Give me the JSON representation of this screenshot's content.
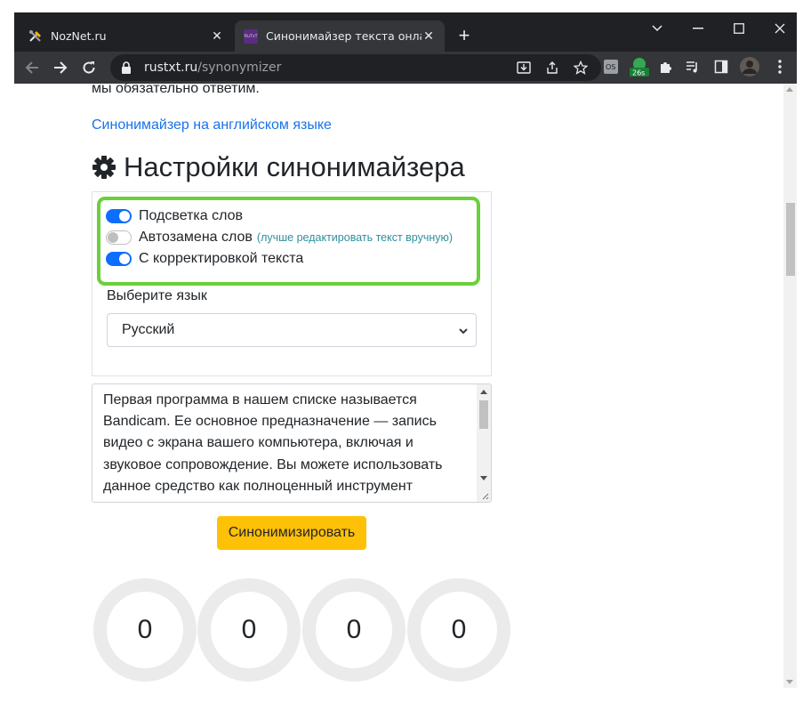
{
  "browser": {
    "tabs": [
      {
        "title": "NozNet.ru",
        "favicon": "tools-icon",
        "active": false
      },
      {
        "title": "Синонимайзер текста онлайн с",
        "favicon": "rustxt-favicon",
        "active": true
      }
    ],
    "new_tab_label": "+",
    "url_host": "rustxt.ru",
    "url_path": "/synonymizer",
    "extension_badge": "26s",
    "colors": {
      "frame": "#202124",
      "toolbar": "#35363a",
      "omnibox": "#202124"
    }
  },
  "page": {
    "intro_text": "мы обязательно ответим.",
    "english_link": "Синонимайзер на английском языке",
    "heading": "Настройки синонимайзера",
    "switches": [
      {
        "label": "Подсветка слов",
        "on": true,
        "hint": ""
      },
      {
        "label": "Автозамена слов",
        "on": false,
        "hint": "(лучше редактировать текст вручную)"
      },
      {
        "label": "С корректировкой текста",
        "on": true,
        "hint": ""
      }
    ],
    "language_label": "Выберите язык",
    "language_selected": "Русский",
    "textarea_text": "Первая программа в нашем списке называется Bandicam. Ее основное предназначение — запись видео с экрана вашего компьютера, включая и звуковое сопровождение. Вы можете использовать данное средство как полноценный инструмент",
    "submit_label": "Синонимизировать",
    "counters": [
      "0",
      "0",
      "0",
      "0"
    ],
    "colors": {
      "link": "#1a73e8",
      "switch_on": "#0d6efd",
      "button": "#ffc107",
      "highlight": "#6bd03a",
      "hint": "#2f8f9d"
    }
  }
}
